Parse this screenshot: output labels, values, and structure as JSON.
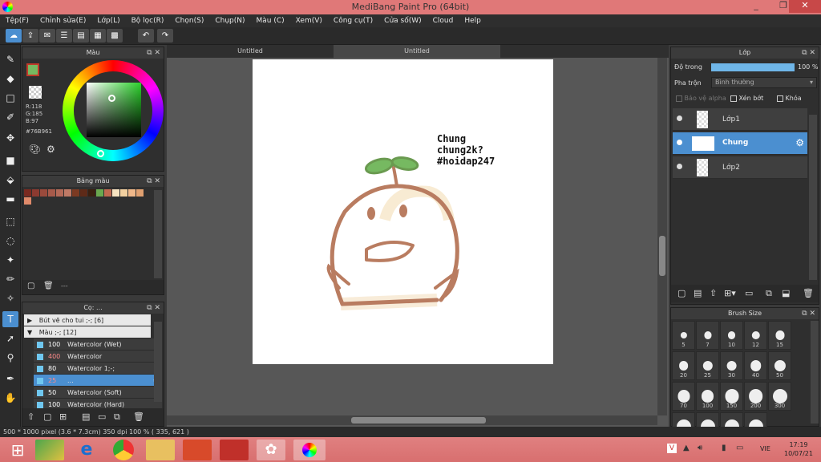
{
  "window": {
    "title": "MediBang Paint Pro (64bit)",
    "minimize": "_",
    "maximize": "❐",
    "close": "✕"
  },
  "menu": [
    "Tệp(F)",
    "Chỉnh sửa(E)",
    "Lớp(L)",
    "Bộ lọc(R)",
    "Chọn(S)",
    "Chụp(N)",
    "Màu (C)",
    "Xem(V)",
    "Công cụ(T)",
    "Cửa số(W)",
    "Cloud",
    "Help"
  ],
  "color_panel": {
    "title": "Màu",
    "r": "R:118",
    "g": "G:185",
    "b": "B:97",
    "hex": "#76B961"
  },
  "palette_panel": {
    "title": "Bảng màu",
    "footer": "---",
    "swatches": [
      "#7a2a20",
      "#8c3a30",
      "#9a4a3c",
      "#a75a4a",
      "#b46a58",
      "#c07a66",
      "#7c3a22",
      "#5e2a18",
      "#3a2010",
      "#6aa84f",
      "#c06a50",
      "#f7e3c0",
      "#f3d0a0",
      "#f0b88a",
      "#e0a070"
    ],
    "swatch2": "#e08a6a"
  },
  "brush_panel": {
    "title": "Cọ: ...",
    "groups": [
      {
        "label": "Bút vẽ cho tui ;-; [6]",
        "arrow": "▶"
      },
      {
        "label": "Màu ;-; [12]",
        "arrow": "▼"
      }
    ],
    "items": [
      {
        "size": "100",
        "name": "Watercolor (Wet)",
        "size_color": "#ffffff"
      },
      {
        "size": "400",
        "name": "Watercolor",
        "size_color": "#ff8a8a"
      },
      {
        "size": "80",
        "name": "Watercolor 1;-;",
        "size_color": "#ffffff"
      },
      {
        "size": "25",
        "name": "...",
        "size_color": "#ff8a8a"
      },
      {
        "size": "50",
        "name": "Watercolor (Soft)",
        "size_color": "#ffffff"
      },
      {
        "size": "100",
        "name": "Watercolor (Hard)",
        "size_color": "#ffffff"
      }
    ]
  },
  "tabs": [
    "Untitled",
    "Untitled"
  ],
  "canvas_text": {
    "line1": "Chung",
    "line2": "chung2k?",
    "line3": "#hoidap247"
  },
  "layer_panel": {
    "title": "Lớp",
    "opacity_label": "Độ trong",
    "opacity_value": "100 %",
    "opacity": 1.0,
    "blend_label": "Pha trộn",
    "blend_value": "Bình thường",
    "options": [
      "Bảo vệ alpha",
      "Xén bớt",
      "Khóa"
    ],
    "layers": [
      {
        "name": "Lớp1",
        "selected": false
      },
      {
        "name": "Chung",
        "selected": true
      },
      {
        "name": "Lớp2",
        "selected": false
      }
    ]
  },
  "brush_size_panel": {
    "title": "Brush Size",
    "sizes": [
      "5",
      "7",
      "10",
      "12",
      "15",
      "20",
      "25",
      "30",
      "40",
      "50",
      "70",
      "100",
      "150",
      "200",
      "300",
      "",
      "",
      "",
      ""
    ]
  },
  "status": {
    "text": "500 * 1000 pixel  (3.6 * 7.3cm)  350 dpi  100 %  ( 335, 621 )"
  },
  "taskbar": {
    "lang": "VIE",
    "time": "17:19",
    "date": "10/07/21"
  }
}
